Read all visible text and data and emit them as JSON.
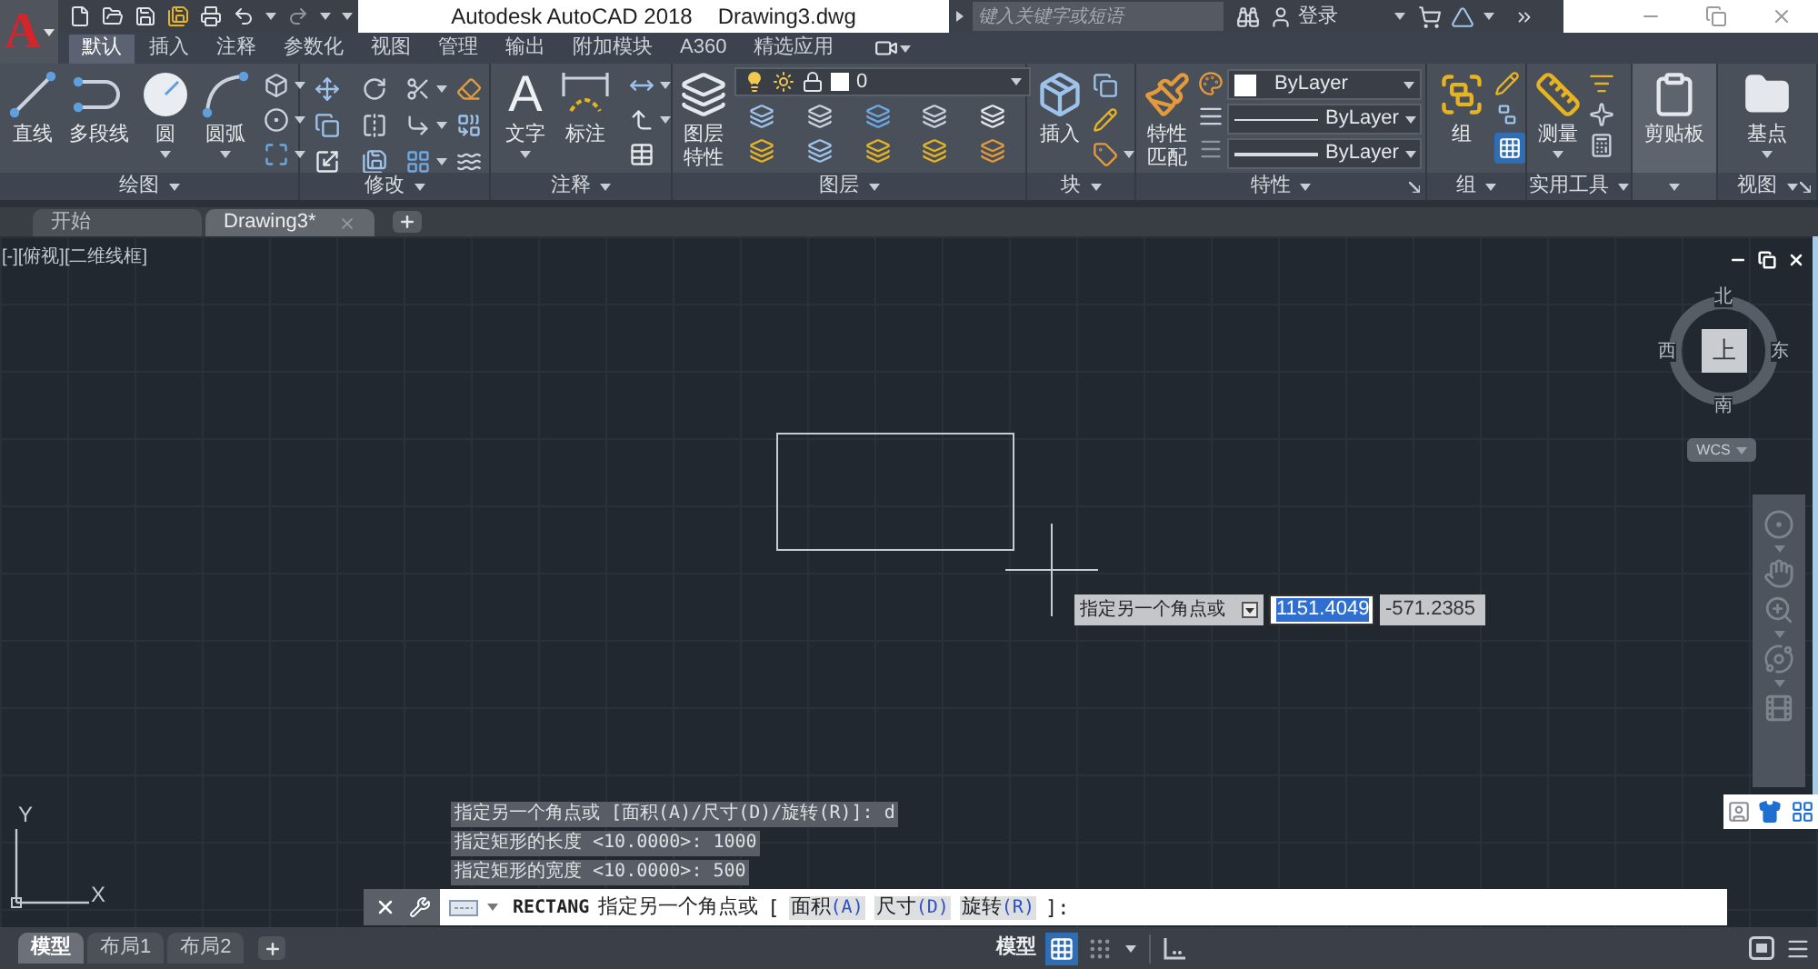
{
  "title_bar": {
    "logo": "A",
    "title": "Autodesk AutoCAD 2018",
    "file": "Drawing3.dwg",
    "search": {
      "placeholder": "键入关键字或短语"
    },
    "sign_in": "登录"
  },
  "ribbon": {
    "tabs": [
      {
        "label": "默认",
        "selected": true
      },
      {
        "label": "插入",
        "selected": false
      },
      {
        "label": "注释",
        "selected": false
      },
      {
        "label": "参数化",
        "selected": false
      },
      {
        "label": "视图",
        "selected": false
      },
      {
        "label": "管理",
        "selected": false
      },
      {
        "label": "输出",
        "selected": false
      },
      {
        "label": "附加模块",
        "selected": false
      },
      {
        "label": "A360",
        "selected": false
      },
      {
        "label": "精选应用",
        "selected": false
      }
    ],
    "panels": [
      {
        "kind": "draw",
        "title": "绘图",
        "tools": [
          {
            "kind": "line",
            "label": "直线",
            "dropdown": false
          },
          {
            "kind": "polyline",
            "label": "多段线",
            "dropdown": false
          },
          {
            "kind": "circle",
            "label": "圆",
            "dropdown": true
          },
          {
            "kind": "arc",
            "label": "圆弧",
            "dropdown": true
          }
        ]
      },
      {
        "kind": "modify",
        "title": "修改"
      },
      {
        "kind": "annotation",
        "title": "注释",
        "tools": [
          {
            "kind": "text",
            "glyph": "A",
            "label": "文字",
            "dropdown": true
          },
          {
            "kind": "dimension",
            "label": "标注",
            "dropdown": false
          }
        ]
      },
      {
        "kind": "layers",
        "title": "图层",
        "tools": [
          {
            "kind": "layer_properties",
            "label": "图层特性",
            "dropdown": false
          }
        ],
        "layer": {
          "name": "0"
        }
      },
      {
        "kind": "block",
        "title": "块",
        "tools": [
          {
            "kind": "insert",
            "label": "插入",
            "dropdown": false
          }
        ]
      },
      {
        "kind": "properties",
        "title": "特性",
        "launcher": true,
        "tools": [
          {
            "kind": "match_properties",
            "label": "特性匹配",
            "dropdown": false
          }
        ],
        "dropdowns": [
          {
            "kind": "color",
            "value": "ByLayer"
          },
          {
            "kind": "linetype",
            "value": "ByLayer"
          },
          {
            "kind": "lineweight",
            "value": "ByLayer"
          }
        ]
      },
      {
        "kind": "groups",
        "title": "组",
        "tools": [
          {
            "kind": "group",
            "label": "组",
            "dropdown": false
          }
        ],
        "selection_toggle": {
          "on": true
        }
      },
      {
        "kind": "utilities",
        "title": "实用工具",
        "tools": [
          {
            "kind": "measure",
            "label": "测量",
            "dropdown": true
          }
        ]
      },
      {
        "kind": "clipboard",
        "tools": [
          {
            "kind": "clipboard",
            "label": "剪贴板",
            "dropdown": false
          }
        ]
      },
      {
        "kind": "view",
        "title": "视图",
        "launcher": true,
        "tools": [
          {
            "kind": "base_point",
            "label": "基点",
            "dropdown": true
          }
        ]
      }
    ]
  },
  "file_tabs": [
    {
      "label": "开始",
      "selected": false
    },
    {
      "label": "Drawing3*",
      "selected": true
    }
  ],
  "viewport": {
    "label": "[-][俯视][二维线框]",
    "viewcube": {
      "face": "上",
      "north": "北",
      "south": "南",
      "west": "西",
      "east": "东",
      "wcs": "WCS"
    },
    "ucs": {
      "x": "X",
      "y": "Y"
    },
    "dynamic_input": {
      "prompt": "指定另一个角点或",
      "fields": [
        {
          "value": "1151.4049",
          "selected": true
        },
        {
          "value": "-571.2385",
          "selected": false
        }
      ]
    }
  },
  "command_history": [
    "指定另一个角点或 [面积(A)/尺寸(D)/旋转(R)]: d",
    "指定矩形的长度 <10.0000>: 1000",
    "指定矩形的宽度 <10.0000>: 500"
  ],
  "command_line": {
    "command": "RECTANG",
    "prompt": "指定另一个角点或",
    "open": "[",
    "options": [
      {
        "label": "面积",
        "key": "(A)"
      },
      {
        "label": "尺寸",
        "key": "(D)"
      },
      {
        "label": "旋转",
        "key": "(R)"
      }
    ],
    "close": "]:"
  },
  "status_bar": {
    "layout_tabs": [
      {
        "label": "模型",
        "selected": true
      },
      {
        "label": "布局1",
        "selected": false
      },
      {
        "label": "布局2",
        "selected": false
      }
    ],
    "space": "模型",
    "toggles": [
      {
        "kind": "grid",
        "on": true
      },
      {
        "kind": "snap",
        "on": false
      }
    ]
  }
}
